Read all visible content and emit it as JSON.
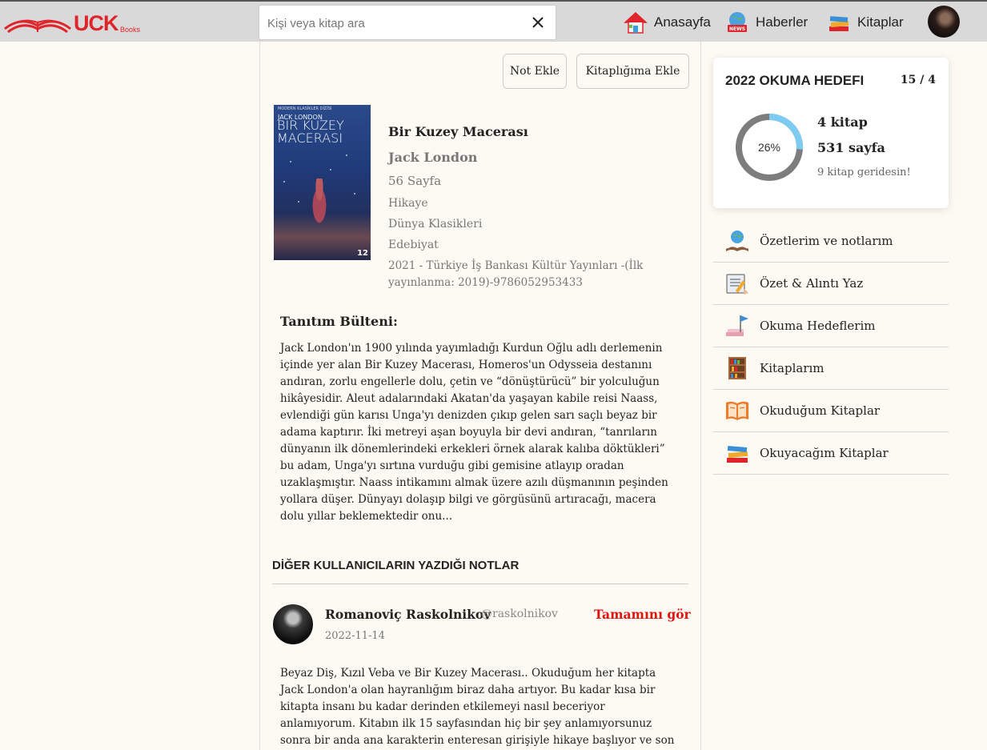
{
  "header": {
    "logo_text": "UCK",
    "logo_sub": "Books",
    "search_placeholder": "Kişi veya kitap ara",
    "nav": [
      {
        "label": "Anasayfa",
        "icon": "home-icon"
      },
      {
        "label": "Haberler",
        "icon": "news-icon"
      },
      {
        "label": "Kitaplar",
        "icon": "books-icon"
      }
    ]
  },
  "actions": {
    "add_note": "Not Ekle",
    "add_to_library": "Kitaplığıma Ekle"
  },
  "book": {
    "cover": {
      "series": "MODERN KLASİKLER DİZİSİ",
      "author": "JACK LONDON",
      "title_line1": "BİR KUZEY",
      "title_line2": "MACERASI",
      "price": "12"
    },
    "title": "Bir Kuzey Macerası",
    "author": "Jack London",
    "pages": "56 Sayfa",
    "genres": [
      "Hikaye",
      "Dünya Klasikleri",
      "Edebiyat"
    ],
    "publication": "2021 - Türkiye İş Bankası Kültür Yayınları -(İlk yayınlanma: 2019)-9786052953433"
  },
  "blurb": {
    "heading": "Tanıtım Bülteni:",
    "text": "Jack London'ın 1900 yılında yayımladığı Kurdun Oğlu adlı derlemenin içinde yer alan Bir Kuzey Macerası, Homeros'un Odysseia destanını andıran, zorlu engellerle dolu, çetin ve “dönüştürücü” bir yolculuğun hikâyesidir. Aleut adalarındaki Akatan'da yaşayan kabile reisi Naass, evlendiği gün karısı Unga'yı denizden çıkıp gelen sarı saçlı beyaz bir adama kaptırır. İki metreyi aşan boyuyla bir devi andıran, “tanrıların dünyanın ilk dönemlerindeki erkekleri örnek alarak kalıba döktükleri” bu adam, Unga'yı sırtına vurduğu gibi gemisine atlayıp oradan uzaklaşmıştır. Naass intikamını almak üzere azılı düşmanının peşinden yollara düşer. Dünyayı dolaşıp bilgi ve görgüsünü artıracağı, macera dolu yıllar beklemektedir onu..."
  },
  "notes": {
    "heading": "DİĞER KULLANICILARIN YAZDIĞI NOTLAR",
    "items": [
      {
        "name": "Romanoviç Raskolnikov",
        "handle": "@raskolnikov",
        "date": "2022-11-14",
        "more": "Tamamını gör",
        "text": "Beyaz Diş, Kızıl Veba ve Bir Kuzey Macerası.. Okuduğum her kitapta Jack London'a olan hayranlığım biraz daha artıyor. Bu kadar kısa bir kitapta insanı bu kadar derinden etkilemeyi nasıl beceriyor anlamıyorum. Kitabın ilk 15 sayfasından hiç bir şey anlamıyorsunuz sonra bir anda ana karakterin enteresan girişiyle hikaye başlıyor ve son cümleye kadar nereye"
      }
    ]
  },
  "goal": {
    "title": "2022 OKUMA HEDEFI",
    "ratio": "15 / 4",
    "percent": 26,
    "percent_label": "26%",
    "books": "4 kitap",
    "pages": "531 sayfa",
    "behind": "9 kitap geridesin!",
    "colors": {
      "progress": "#7ecbf2",
      "track": "#7d7d7d"
    }
  },
  "menu": [
    {
      "label": "Özetlerim ve notlarım",
      "icon": "globe-book-icon"
    },
    {
      "label": "Özet & Alıntı Yaz",
      "icon": "write-notes-icon"
    },
    {
      "label": "Okuma Hedeflerim",
      "icon": "goal-flag-icon"
    },
    {
      "label": "Kitaplarım",
      "icon": "bookshelf-icon"
    },
    {
      "label": "Okuduğum Kitaplar",
      "icon": "open-book-icon"
    },
    {
      "label": "Okuyacağım Kitaplar",
      "icon": "book-stack-icon"
    }
  ]
}
